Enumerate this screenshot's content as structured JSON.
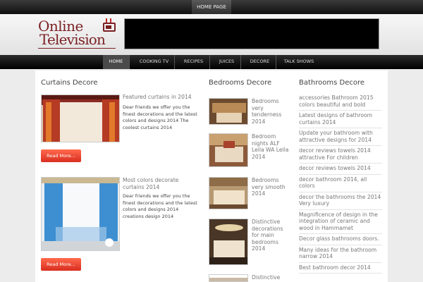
{
  "topbar": {
    "home_label": "HOME PAGE"
  },
  "logo": {
    "line1": "Online",
    "line2": "Television"
  },
  "nav": {
    "items": [
      "HOME",
      "COOKING TV",
      "RECIPES",
      "JUICES",
      "DECORE",
      "TALK SHOWS"
    ]
  },
  "sections": {
    "curtains": {
      "title": "Curtains Decore",
      "posts": [
        {
          "title": "Featured curtains in 2014",
          "excerpt": "Dear friends we offer you the finest decorations and the latest colors and designs 2014    The coolest curtains 2014",
          "readmore": "Read More..."
        },
        {
          "title": "Most colors decorate curtains 2014",
          "excerpt": "Dear friends we offer you the finest decorations and the latest colors and designs 2014 creations  design  2014",
          "readmore": "Read More..."
        }
      ]
    },
    "bedrooms": {
      "title": "Bedrooms Decore",
      "items": [
        "Bedrooms very tenderness 2014",
        "Bedroom nights ALF Leila WA Leila 2014",
        "Bedrooms very smooth 2014",
        "Distinctive decorations for main bedrooms 2014",
        "Distinctive"
      ]
    },
    "bathrooms": {
      "title": "Bathrooms Decore",
      "items": [
        "accessories Bathroom 2015 colors beautiful and bold",
        "Latest designs of bathroom curtains 2014",
        "Update your bathroom with attractive designs for 2014",
        "decor reviews towels 2014 attractive For children",
        "decor reviews towels 2014",
        "decor bathroom 2014, all colors",
        "decor the bathrooms the 2014 Very luxury",
        "Magnificence of design in the integration of ceramic and wood in Hammamet",
        "Decor glass bathrooms doors.",
        "Many ideas for the bathroom narrow 2014",
        "Best bathroom decor 2014"
      ]
    }
  },
  "colors": {
    "logo": "#7b1f22",
    "accent": "#d92d1f",
    "nav": "#000000"
  }
}
